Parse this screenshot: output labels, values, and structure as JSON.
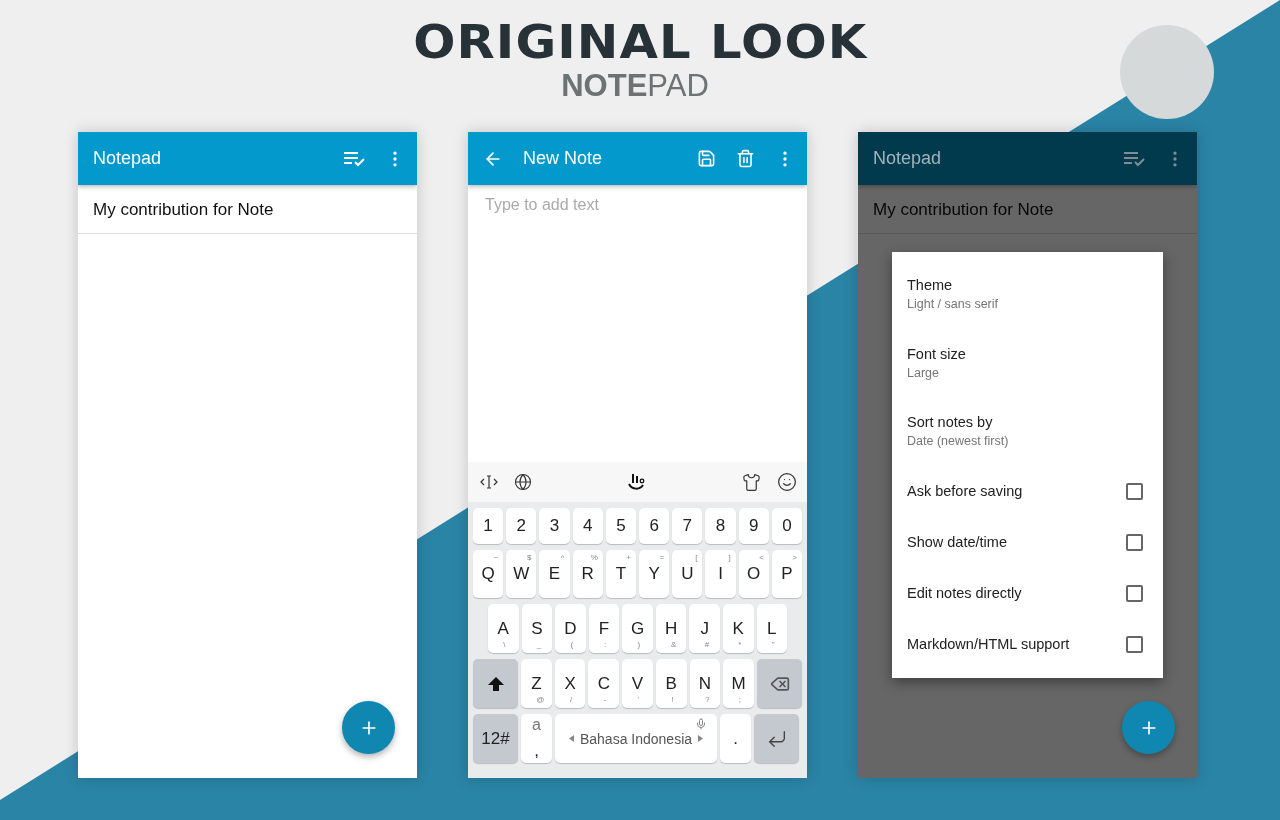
{
  "heading": {
    "title": "ORIGINAL LOOK",
    "subtitle": "**NOTE**PAD"
  },
  "phones": [
    {
      "kind": "list",
      "title": "Notepad",
      "notes": [
        "My contribution for Note"
      ]
    },
    {
      "kind": "editor",
      "title": "New Note",
      "placeholder": "Type to add text",
      "keyboard": {
        "language": "Bahasa Indonesia",
        "rows": [
          [
            {
              "kind": "char",
              "main": "1"
            },
            {
              "kind": "char",
              "main": "2"
            },
            {
              "kind": "char",
              "main": "3"
            },
            {
              "kind": "char",
              "main": "4"
            },
            {
              "kind": "char",
              "main": "5"
            },
            {
              "kind": "char",
              "main": "6"
            },
            {
              "kind": "char",
              "main": "7"
            },
            {
              "kind": "char",
              "main": "8"
            },
            {
              "kind": "char",
              "main": "9"
            },
            {
              "kind": "char",
              "main": "0"
            }
          ],
          [
            {
              "kind": "char",
              "main": "Q",
              "sub": "~"
            },
            {
              "kind": "char",
              "main": "W",
              "sub": "$"
            },
            {
              "kind": "char",
              "main": "E",
              "sub": "^"
            },
            {
              "kind": "char",
              "main": "R",
              "sub": "%"
            },
            {
              "kind": "char",
              "main": "T",
              "sub": "+"
            },
            {
              "kind": "char",
              "main": "Y",
              "sub": "="
            },
            {
              "kind": "char",
              "main": "U",
              "sub": "["
            },
            {
              "kind": "char",
              "main": "I",
              "sub": "]"
            },
            {
              "kind": "char",
              "main": "O",
              "sub": "<"
            },
            {
              "kind": "char",
              "main": "P",
              "sub": ">"
            }
          ],
          [
            {
              "kind": "char",
              "main": "A",
              "sub": "\\"
            },
            {
              "kind": "char",
              "main": "S",
              "sub": "_"
            },
            {
              "kind": "char",
              "main": "D",
              "sub": "("
            },
            {
              "kind": "char",
              "main": "F",
              "sub": ":"
            },
            {
              "kind": "char",
              "main": "G",
              "sub": ")"
            },
            {
              "kind": "char",
              "main": "H",
              "sub": "&"
            },
            {
              "kind": "char",
              "main": "J",
              "sub": "#"
            },
            {
              "kind": "char",
              "main": "K",
              "sub": "*"
            },
            {
              "kind": "char",
              "main": "L",
              "sub": "\""
            }
          ],
          [
            {
              "kind": "shift"
            },
            {
              "kind": "char",
              "main": "Z",
              "sub": "@"
            },
            {
              "kind": "char",
              "main": "X",
              "sub": "/"
            },
            {
              "kind": "char",
              "main": "C",
              "sub": "-"
            },
            {
              "kind": "char",
              "main": "V",
              "sub": "'"
            },
            {
              "kind": "char",
              "main": "B",
              "sub": "!"
            },
            {
              "kind": "char",
              "main": "N",
              "sub": "?"
            },
            {
              "kind": "char",
              "main": "M",
              "sub": ";"
            },
            {
              "kind": "backspace"
            }
          ],
          [
            {
              "kind": "mode",
              "main": "12#"
            },
            {
              "kind": "comma",
              "main": ",",
              "sub": "a"
            },
            {
              "kind": "space"
            },
            {
              "kind": "char",
              "main": "."
            },
            {
              "kind": "enter"
            }
          ]
        ]
      }
    },
    {
      "kind": "list",
      "title": "Notepad",
      "notes": [
        "My contribution for Note"
      ],
      "dialog": {
        "items": [
          {
            "kind": "choice",
            "title": "Theme",
            "value": "Light / sans serif"
          },
          {
            "kind": "choice",
            "title": "Font size",
            "value": "Large"
          },
          {
            "kind": "choice",
            "title": "Sort notes by",
            "value": "Date (newest first)"
          },
          {
            "kind": "toggle",
            "title": "Ask before saving",
            "checked": false
          },
          {
            "kind": "toggle",
            "title": "Show date/time",
            "checked": false
          },
          {
            "kind": "toggle",
            "title": "Edit notes directly",
            "checked": false
          },
          {
            "kind": "toggle",
            "title": "Markdown/HTML support",
            "checked": false
          }
        ]
      }
    }
  ]
}
